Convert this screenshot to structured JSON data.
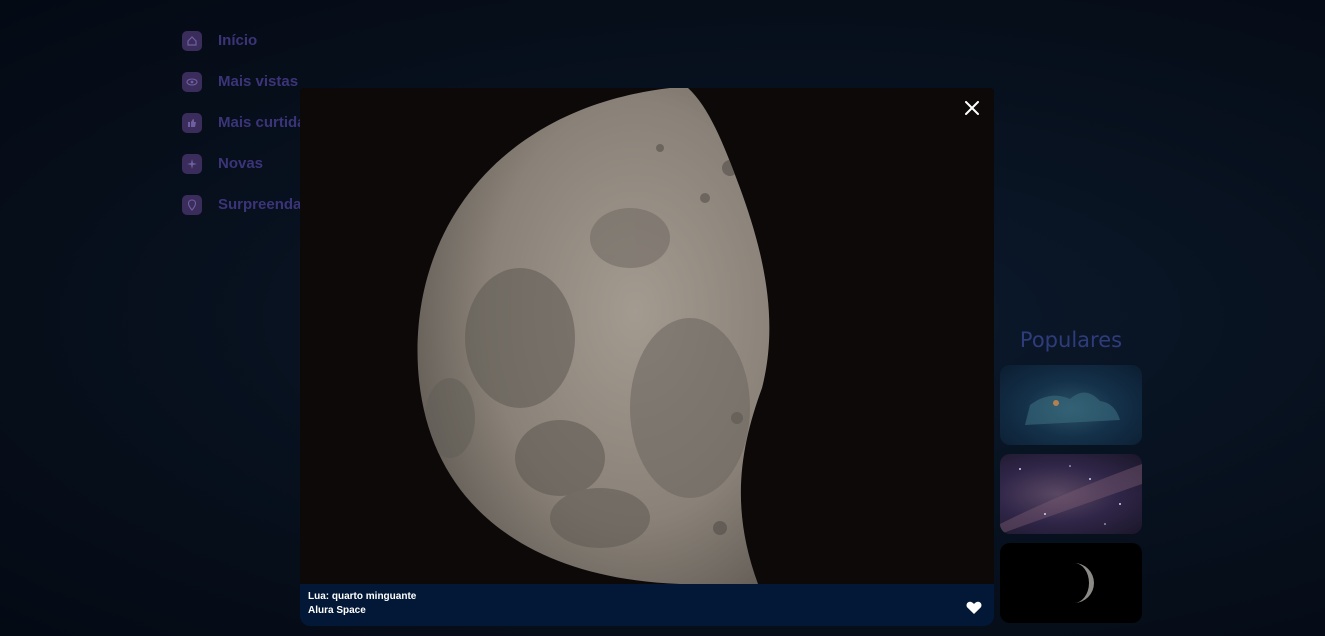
{
  "sidebar": {
    "items": [
      {
        "label": "Início",
        "icon": "home-icon"
      },
      {
        "label": "Mais vistas",
        "icon": "eye-icon"
      },
      {
        "label": "Mais curtidas",
        "icon": "thumbs-up-icon"
      },
      {
        "label": "Novas",
        "icon": "sparkle-icon"
      },
      {
        "label": "Surpreenda-me",
        "icon": "location-pin-icon"
      }
    ]
  },
  "populares": {
    "title": "Populares"
  },
  "modal": {
    "photo_title": "Lua: quarto minguante",
    "photo_author": "Alura Space",
    "close_icon": "close-icon",
    "favorite_icon": "heart-icon"
  },
  "colors": {
    "caption_bar": "#021836",
    "nav_label": "#3c3479",
    "background": "#07101d"
  }
}
